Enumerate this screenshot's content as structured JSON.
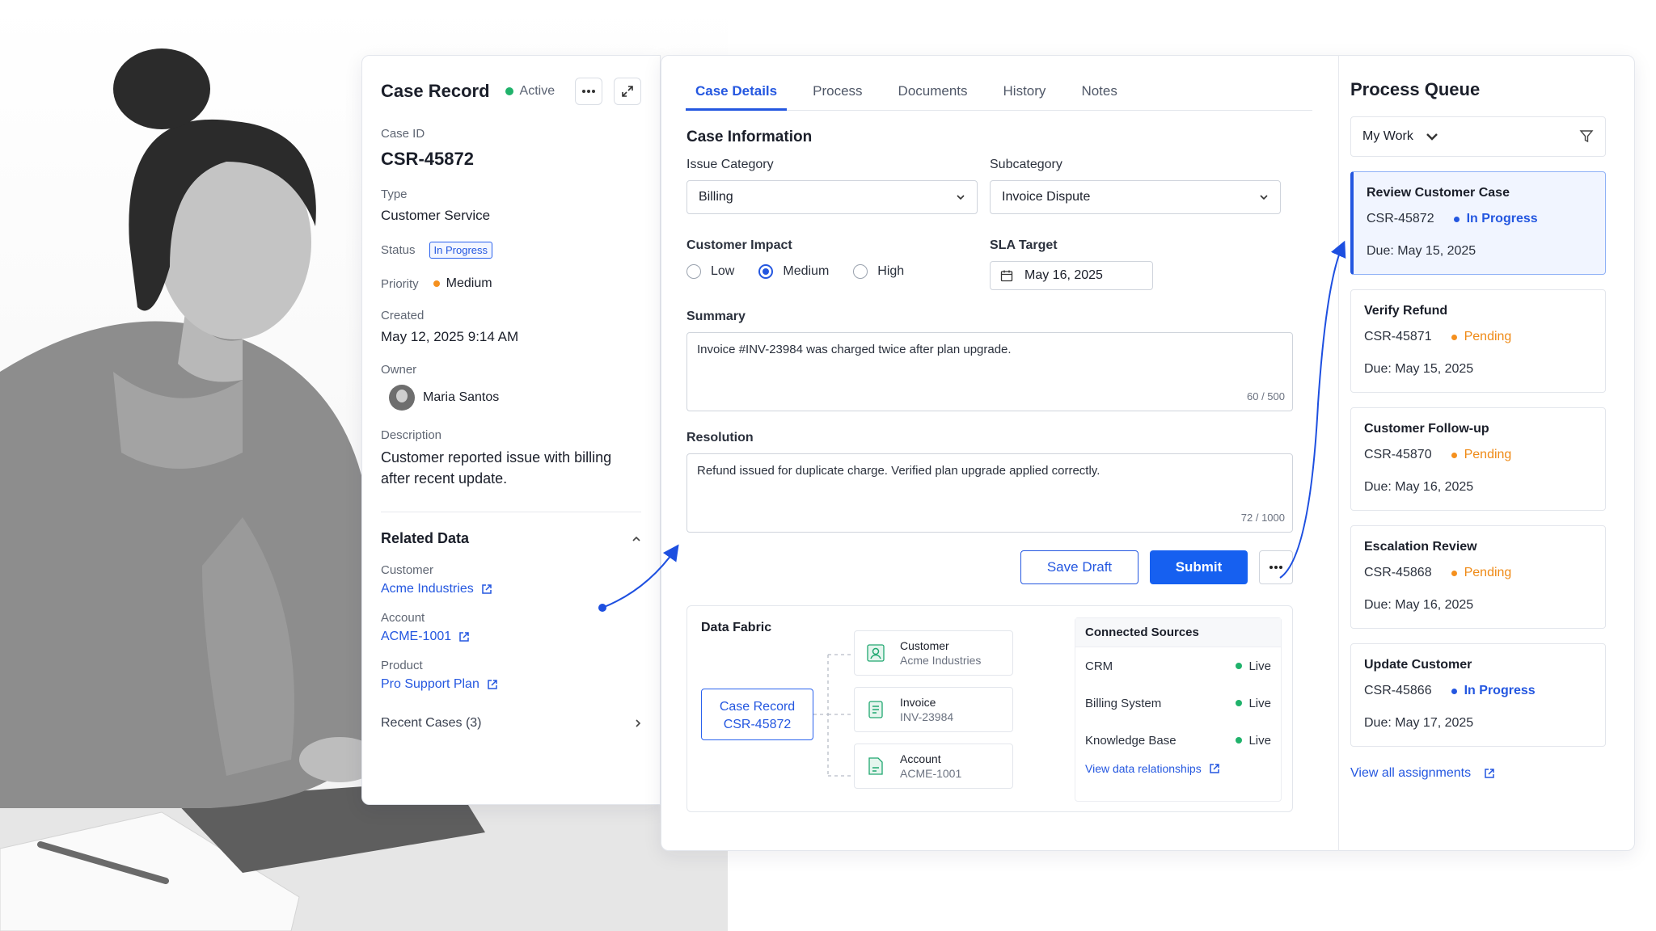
{
  "colors": {
    "accent": "#2457e0",
    "success": "#20b26b",
    "warning": "#f5901e"
  },
  "case_record": {
    "title": "Case Record",
    "active_label": "Active",
    "case_id_label": "Case ID",
    "case_id": "CSR-45872",
    "type_label": "Type",
    "type": "Customer Service",
    "status_label": "Status",
    "status": "In Progress",
    "priority_label": "Priority",
    "priority": "Medium",
    "created_label": "Created",
    "created": "May 12, 2025 9:14 AM",
    "owner_label": "Owner",
    "owner": "Maria Santos",
    "description_label": "Description",
    "description": "Customer reported issue with billing after recent update.",
    "related": {
      "title": "Related Data",
      "customer_label": "Customer",
      "customer": "Acme Industries",
      "account_label": "Account",
      "account": "ACME-1001",
      "product_label": "Product",
      "product": "Pro Support Plan",
      "recent_cases": "Recent Cases (3)"
    }
  },
  "tabs": [
    "Case Details",
    "Process",
    "Documents",
    "History",
    "Notes"
  ],
  "case_info": {
    "title": "Case Information",
    "issue_category_label": "Issue Category",
    "issue_category": "Billing",
    "subcategory_label": "Subcategory",
    "subcategory": "Invoice Dispute",
    "impact_label": "Customer Impact",
    "impact_options": [
      "Low",
      "Medium",
      "High"
    ],
    "impact_selected": "Medium",
    "sla_label": "SLA Target",
    "sla_date": "May 16, 2025",
    "summary_label": "Summary",
    "summary": "Invoice #INV-23984 was charged twice after plan upgrade.",
    "summary_count": "60 / 500",
    "resolution_label": "Resolution",
    "resolution": "Refund issued for duplicate charge. Verified plan upgrade applied correctly.",
    "resolution_count": "72 / 1000",
    "save_draft": "Save Draft",
    "submit": "Submit"
  },
  "data_fabric": {
    "title": "Data Fabric",
    "case_label": "Case Record",
    "case_id": "CSR-45872",
    "nodes": [
      {
        "title": "Customer",
        "sub": "Acme Industries",
        "icon": "user-icon"
      },
      {
        "title": "Invoice",
        "sub": "INV-23984",
        "icon": "document-icon"
      },
      {
        "title": "Account",
        "sub": "ACME-1001",
        "icon": "account-icon"
      }
    ],
    "sources_title": "Connected Sources",
    "sources": [
      {
        "name": "CRM",
        "status": "Live"
      },
      {
        "name": "Billing System",
        "status": "Live"
      },
      {
        "name": "Knowledge Base",
        "status": "Live"
      }
    ],
    "link": "View data relationships"
  },
  "queue": {
    "title": "Process Queue",
    "filter": "My Work",
    "items": [
      {
        "title": "Review Customer Case",
        "id": "CSR-45872",
        "status": "In Progress",
        "due": "Due: May 15, 2025"
      },
      {
        "title": "Verify Refund",
        "id": "CSR-45871",
        "status": "Pending",
        "due": "Due: May 15, 2025"
      },
      {
        "title": "Customer Follow-up",
        "id": "CSR-45870",
        "status": "Pending",
        "due": "Due: May 16, 2025"
      },
      {
        "title": "Escalation Review",
        "id": "CSR-45868",
        "status": "Pending",
        "due": "Due: May 16, 2025"
      },
      {
        "title": "Update Customer",
        "id": "CSR-45866",
        "status": "In Progress",
        "due": "Due: May 17, 2025"
      }
    ],
    "link": "View all assignments"
  }
}
